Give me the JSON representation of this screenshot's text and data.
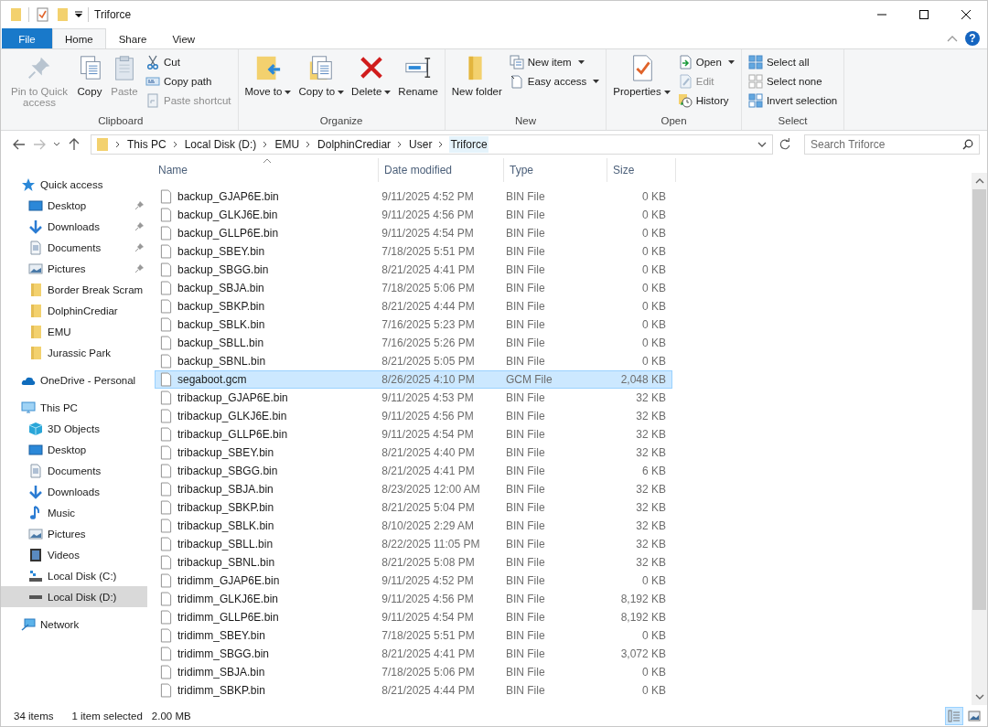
{
  "window": {
    "title": "Triforce"
  },
  "ribbon": {
    "tabs": [
      {
        "label": "File",
        "kind": "file",
        "selected": false
      },
      {
        "label": "Home",
        "kind": "tab",
        "selected": true
      },
      {
        "label": "Share",
        "kind": "tab",
        "selected": false
      },
      {
        "label": "View",
        "kind": "tab",
        "selected": false
      }
    ],
    "help_label": "?",
    "groups": [
      {
        "label": "Clipboard",
        "items": [
          {
            "label": "Pin to Quick access",
            "kind": "large",
            "disabled": true,
            "has_menu": false
          },
          {
            "label": "Copy",
            "kind": "large",
            "disabled": false,
            "has_menu": false
          },
          {
            "label": "Paste",
            "kind": "large",
            "disabled": true,
            "has_menu": false
          },
          {
            "label": "Cut",
            "kind": "small",
            "disabled": false,
            "has_menu": false
          },
          {
            "label": "Copy path",
            "kind": "small",
            "disabled": false,
            "has_menu": false
          },
          {
            "label": "Paste shortcut",
            "kind": "small",
            "disabled": true,
            "has_menu": false
          }
        ]
      },
      {
        "label": "Organize",
        "items": [
          {
            "label": "Move to",
            "kind": "large",
            "disabled": false,
            "has_menu": true
          },
          {
            "label": "Copy to",
            "kind": "large",
            "disabled": false,
            "has_menu": true
          },
          {
            "label": "Delete",
            "kind": "large",
            "disabled": false,
            "has_menu": true
          },
          {
            "label": "Rename",
            "kind": "large",
            "disabled": false,
            "has_menu": false
          }
        ]
      },
      {
        "label": "New",
        "items": [
          {
            "label": "New folder",
            "kind": "large",
            "disabled": false,
            "has_menu": false
          },
          {
            "label": "New item",
            "kind": "small",
            "disabled": false,
            "has_menu": true
          },
          {
            "label": "Easy access",
            "kind": "small",
            "disabled": false,
            "has_menu": true
          }
        ]
      },
      {
        "label": "Open",
        "items": [
          {
            "label": "Properties",
            "kind": "large",
            "disabled": false,
            "has_menu": true
          },
          {
            "label": "Open",
            "kind": "small",
            "disabled": false,
            "has_menu": true
          },
          {
            "label": "Edit",
            "kind": "small",
            "disabled": true,
            "has_menu": false
          },
          {
            "label": "History",
            "kind": "small",
            "disabled": false,
            "has_menu": false
          }
        ]
      },
      {
        "label": "Select",
        "items": [
          {
            "label": "Select all",
            "kind": "small",
            "disabled": false,
            "has_menu": false
          },
          {
            "label": "Select none",
            "kind": "small",
            "disabled": false,
            "has_menu": false
          },
          {
            "label": "Invert selection",
            "kind": "small",
            "disabled": false,
            "has_menu": false
          }
        ]
      }
    ]
  },
  "address_bar": {
    "breadcrumbs": [
      "This PC",
      "Local Disk (D:)",
      "EMU",
      "DolphinCrediar",
      "User",
      "Triforce"
    ]
  },
  "search": {
    "placeholder": "Search Triforce"
  },
  "sidebar": {
    "sections": [
      {
        "label": "Quick access",
        "selected": false,
        "children": [
          {
            "label": "Desktop",
            "pinned": true,
            "selected": false
          },
          {
            "label": "Downloads",
            "pinned": true,
            "selected": false
          },
          {
            "label": "Documents",
            "pinned": true,
            "selected": false
          },
          {
            "label": "Pictures",
            "pinned": true,
            "selected": false
          },
          {
            "label": "Border Break Scram",
            "pinned": false,
            "selected": false
          },
          {
            "label": "DolphinCrediar",
            "pinned": false,
            "selected": false
          },
          {
            "label": "EMU",
            "pinned": false,
            "selected": false
          },
          {
            "label": "Jurassic Park",
            "pinned": false,
            "selected": false
          }
        ]
      },
      {
        "label": "OneDrive - Personal",
        "selected": false
      },
      {
        "label": "This PC",
        "selected": false,
        "children": [
          {
            "label": "3D Objects",
            "pinned": false,
            "selected": false
          },
          {
            "label": "Desktop",
            "pinned": false,
            "selected": false
          },
          {
            "label": "Documents",
            "pinned": false,
            "selected": false
          },
          {
            "label": "Downloads",
            "pinned": false,
            "selected": false
          },
          {
            "label": "Music",
            "pinned": false,
            "selected": false
          },
          {
            "label": "Pictures",
            "pinned": false,
            "selected": false
          },
          {
            "label": "Videos",
            "pinned": false,
            "selected": false
          },
          {
            "label": "Local Disk (C:)",
            "pinned": false,
            "selected": false
          },
          {
            "label": "Local Disk (D:)",
            "pinned": false,
            "selected": true
          }
        ]
      },
      {
        "label": "Network",
        "selected": false
      }
    ]
  },
  "table": {
    "columns": [
      "Name",
      "Date modified",
      "Type",
      "Size"
    ],
    "rows": [
      {
        "name": "backup_GJAP6E.bin",
        "date": "9/11/2025 4:52 PM",
        "type": "BIN File",
        "size": "0 KB",
        "selected": false
      },
      {
        "name": "backup_GLKJ6E.bin",
        "date": "9/11/2025 4:56 PM",
        "type": "BIN File",
        "size": "0 KB",
        "selected": false
      },
      {
        "name": "backup_GLLP6E.bin",
        "date": "9/11/2025 4:54 PM",
        "type": "BIN File",
        "size": "0 KB",
        "selected": false
      },
      {
        "name": "backup_SBEY.bin",
        "date": "7/18/2025 5:51 PM",
        "type": "BIN File",
        "size": "0 KB",
        "selected": false
      },
      {
        "name": "backup_SBGG.bin",
        "date": "8/21/2025 4:41 PM",
        "type": "BIN File",
        "size": "0 KB",
        "selected": false
      },
      {
        "name": "backup_SBJA.bin",
        "date": "7/18/2025 5:06 PM",
        "type": "BIN File",
        "size": "0 KB",
        "selected": false
      },
      {
        "name": "backup_SBKP.bin",
        "date": "8/21/2025 4:44 PM",
        "type": "BIN File",
        "size": "0 KB",
        "selected": false
      },
      {
        "name": "backup_SBLK.bin",
        "date": "7/16/2025 5:23 PM",
        "type": "BIN File",
        "size": "0 KB",
        "selected": false
      },
      {
        "name": "backup_SBLL.bin",
        "date": "7/16/2025 5:26 PM",
        "type": "BIN File",
        "size": "0 KB",
        "selected": false
      },
      {
        "name": "backup_SBNL.bin",
        "date": "8/21/2025 5:05 PM",
        "type": "BIN File",
        "size": "0 KB",
        "selected": false
      },
      {
        "name": "segaboot.gcm",
        "date": "8/26/2025 4:10 PM",
        "type": "GCM File",
        "size": "2,048 KB",
        "selected": true
      },
      {
        "name": "tribackup_GJAP6E.bin",
        "date": "9/11/2025 4:53 PM",
        "type": "BIN File",
        "size": "32 KB",
        "selected": false
      },
      {
        "name": "tribackup_GLKJ6E.bin",
        "date": "9/11/2025 4:56 PM",
        "type": "BIN File",
        "size": "32 KB",
        "selected": false
      },
      {
        "name": "tribackup_GLLP6E.bin",
        "date": "9/11/2025 4:54 PM",
        "type": "BIN File",
        "size": "32 KB",
        "selected": false
      },
      {
        "name": "tribackup_SBEY.bin",
        "date": "8/21/2025 4:40 PM",
        "type": "BIN File",
        "size": "32 KB",
        "selected": false
      },
      {
        "name": "tribackup_SBGG.bin",
        "date": "8/21/2025 4:41 PM",
        "type": "BIN File",
        "size": "6 KB",
        "selected": false
      },
      {
        "name": "tribackup_SBJA.bin",
        "date": "8/23/2025 12:00 AM",
        "type": "BIN File",
        "size": "32 KB",
        "selected": false
      },
      {
        "name": "tribackup_SBKP.bin",
        "date": "8/21/2025 5:04 PM",
        "type": "BIN File",
        "size": "32 KB",
        "selected": false
      },
      {
        "name": "tribackup_SBLK.bin",
        "date": "8/10/2025 2:29 AM",
        "type": "BIN File",
        "size": "32 KB",
        "selected": false
      },
      {
        "name": "tribackup_SBLL.bin",
        "date": "8/22/2025 11:05 PM",
        "type": "BIN File",
        "size": "32 KB",
        "selected": false
      },
      {
        "name": "tribackup_SBNL.bin",
        "date": "8/21/2025 5:08 PM",
        "type": "BIN File",
        "size": "32 KB",
        "selected": false
      },
      {
        "name": "tridimm_GJAP6E.bin",
        "date": "9/11/2025 4:52 PM",
        "type": "BIN File",
        "size": "0 KB",
        "selected": false
      },
      {
        "name": "tridimm_GLKJ6E.bin",
        "date": "9/11/2025 4:56 PM",
        "type": "BIN File",
        "size": "8,192 KB",
        "selected": false
      },
      {
        "name": "tridimm_GLLP6E.bin",
        "date": "9/11/2025 4:54 PM",
        "type": "BIN File",
        "size": "8,192 KB",
        "selected": false
      },
      {
        "name": "tridimm_SBEY.bin",
        "date": "7/18/2025 5:51 PM",
        "type": "BIN File",
        "size": "0 KB",
        "selected": false
      },
      {
        "name": "tridimm_SBGG.bin",
        "date": "8/21/2025 4:41 PM",
        "type": "BIN File",
        "size": "3,072 KB",
        "selected": false
      },
      {
        "name": "tridimm_SBJA.bin",
        "date": "7/18/2025 5:06 PM",
        "type": "BIN File",
        "size": "0 KB",
        "selected": false
      },
      {
        "name": "tridimm_SBKP.bin",
        "date": "8/21/2025 4:44 PM",
        "type": "BIN File",
        "size": "0 KB",
        "selected": false
      }
    ]
  },
  "status_bar": {
    "item_count": "34 items",
    "selection": "1 item selected",
    "selection_size": "2.00 MB",
    "views": [
      {
        "selected": true
      },
      {
        "selected": false
      }
    ]
  }
}
